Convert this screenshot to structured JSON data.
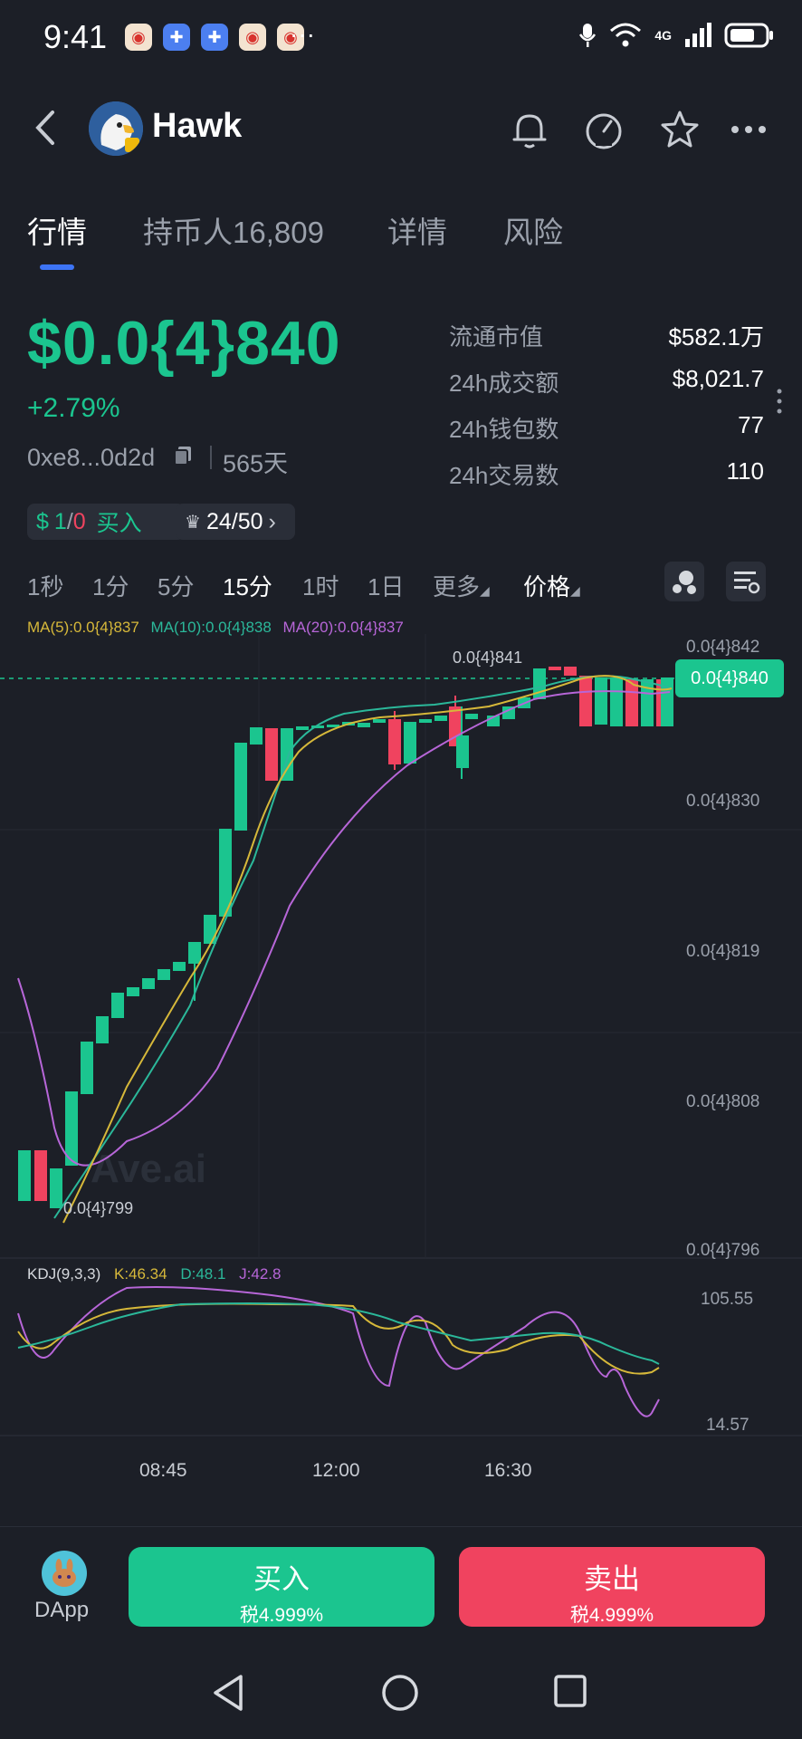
{
  "status_bar": {
    "time": "9:41",
    "overflow": "···",
    "network": "4G"
  },
  "header": {
    "back_icon": "chevron-left-icon",
    "title": "Hawk",
    "icons": [
      "bell-icon",
      "gauge-icon",
      "star-icon",
      "more-icon"
    ]
  },
  "tabs": [
    {
      "label": "行情",
      "active": true
    },
    {
      "label": "持币人16,809",
      "active": false
    },
    {
      "label": "详情",
      "active": false
    },
    {
      "label": "风险",
      "active": false
    }
  ],
  "token": {
    "price": "$0.0{4}840",
    "change": "+2.79%",
    "address": "0xe8...0d2d",
    "age": "565天",
    "buy_sell_ratio_buy": "1",
    "buy_sell_ratio_sell": "0",
    "buy_label": "买入",
    "rank": "24/50"
  },
  "stats": [
    {
      "label": "流通市值",
      "value": "$582.1万"
    },
    {
      "label": "24h成交额",
      "value": "$8,021.7"
    },
    {
      "label": "24h钱包数",
      "value": "77"
    },
    {
      "label": "24h交易数",
      "value": "110"
    }
  ],
  "timeframes": [
    {
      "label": "1秒",
      "active": false
    },
    {
      "label": "1分",
      "active": false
    },
    {
      "label": "5分",
      "active": false
    },
    {
      "label": "15分",
      "active": true
    },
    {
      "label": "1时",
      "active": false
    },
    {
      "label": "1日",
      "active": false
    },
    {
      "label": "更多",
      "active": false
    },
    {
      "label": "价格",
      "active": true
    }
  ],
  "ma_legend": {
    "ma5": "MA(5):0.0{4}837",
    "ma10": "MA(10):0.0{4}838",
    "ma20": "MA(20):0.0{4}837"
  },
  "kdj_legend": {
    "name": "KDJ(9,3,3)",
    "k": "K:46.34",
    "d": "D:48.1",
    "j": "J:42.8"
  },
  "chart_data": {
    "type": "candlestick",
    "y_ticks": [
      "0.0{4}842",
      "0.0{4}830",
      "0.0{4}819",
      "0.0{4}808",
      "0.0{4}796"
    ],
    "x_ticks": [
      "08:45",
      "12:00",
      "16:30"
    ],
    "high_label": "0.0{4}841",
    "low_label": "0.0{4}799",
    "current_price_label": "0.0{4}840",
    "watermark": "Ave.ai",
    "kdj_ticks": [
      "105.55",
      "14.57"
    ],
    "ylim": [
      7.96e-05,
      8.42e-05
    ]
  },
  "actions": {
    "dapp_label": "DApp",
    "buy": {
      "label": "买入",
      "tax": "税4.999%"
    },
    "sell": {
      "label": "卖出",
      "tax": "税4.999%"
    }
  },
  "colors": {
    "up": "#1bc58f",
    "down": "#f0435f",
    "ma5": "#d6b83a",
    "ma10": "#2bb89a",
    "ma20": "#b766d8",
    "accent": "#3d74f5"
  }
}
